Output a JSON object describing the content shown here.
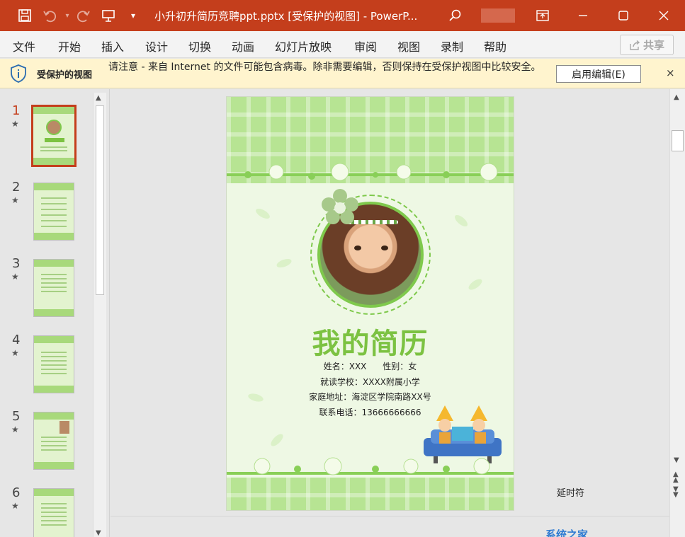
{
  "titlebar": {
    "title": "小升初升简历竞聘ppt.pptx [受保护的视图]  -  PowerP...",
    "icons": [
      "save-icon",
      "undo-icon",
      "redo-icon",
      "present-icon",
      "customize-icon",
      "search-icon",
      "ribbon-display-icon",
      "minimize-icon",
      "maximize-icon",
      "close-icon"
    ]
  },
  "menu": {
    "items": [
      "文件",
      "开始",
      "插入",
      "设计",
      "切换",
      "动画",
      "幻灯片放映",
      "审阅",
      "视图",
      "录制",
      "帮助"
    ],
    "share_label": "共享"
  },
  "banner": {
    "title": "受保护的视图",
    "message": "请注意 - 来自 Internet 的文件可能包含病毒。除非需要编辑，否则保持在受保护视图中比较安全。",
    "enable_label": "启用编辑(E)",
    "close_glyph": "×"
  },
  "thumbnails": {
    "numbers": [
      "1",
      "2",
      "3",
      "4",
      "5",
      "6"
    ],
    "star": "★",
    "active_index": 1
  },
  "slide": {
    "title": "我的简历",
    "name_gender": "姓名：XXX      性别：女",
    "school": "就读学校：XXXX附属小学",
    "address": "家庭地址：海淀区学院南路XX号",
    "phone": "联系电话：13666666666"
  },
  "notes_label": "延时符",
  "watermark": "系统之家",
  "colors": {
    "titlebar": "#c43e1c",
    "banner": "#fff4ce",
    "slide_green": "#7cc242",
    "plaid": "#b7e493"
  }
}
